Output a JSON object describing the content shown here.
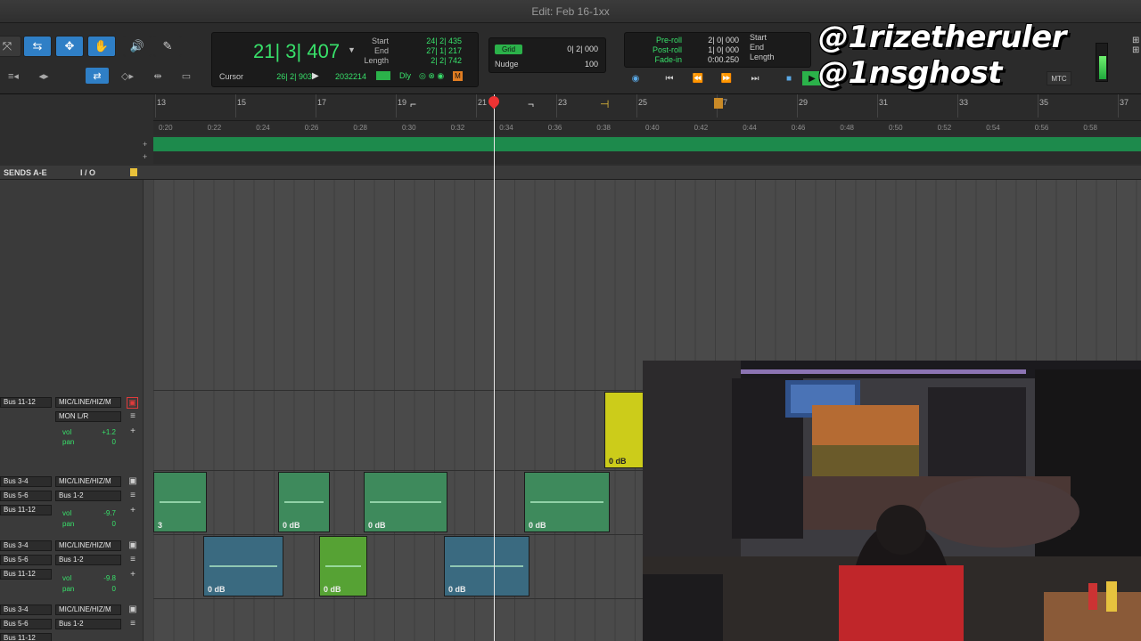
{
  "window": {
    "title": "Edit: Feb 16-1xx"
  },
  "counter": {
    "main": "21| 3| 407",
    "start_label": "Start",
    "start_value": "24| 2| 435",
    "end_label": "End",
    "end_value": "27| 1| 217",
    "length_label": "Length",
    "length_value": "2| 2| 742",
    "cursor_label": "Cursor",
    "cursor_value": "26| 2| 903",
    "samples": "2032214",
    "dly_label": "Dly",
    "m_label": "M"
  },
  "grid": {
    "label": "Grid",
    "value": "0| 2| 000",
    "nudge_label": "Nudge",
    "nudge_value": "100"
  },
  "preroll": {
    "preroll_label": "Pre-roll",
    "preroll_value": "2| 0| 000",
    "postroll_label": "Post-roll",
    "postroll_value": "1| 0| 000",
    "fadein_label": "Fade-in",
    "fadein_value": "0:00.250",
    "start_label": "Start",
    "end_label": "End",
    "length_label": "Length"
  },
  "transport": {
    "mtc": "MTC"
  },
  "overlay": {
    "line1": "@1rizetheruler",
    "line2": "@1nsghost"
  },
  "bar_ruler": [
    "13",
    "15",
    "17",
    "19",
    "21",
    "23",
    "25",
    "27",
    "29",
    "31",
    "33",
    "35",
    "37"
  ],
  "time_ruler": [
    "0:20",
    "0:22",
    "0:24",
    "0:26",
    "0:28",
    "0:30",
    "0:32",
    "0:34",
    "0:36",
    "0:38",
    "0:40",
    "0:42",
    "0:44",
    "0:46",
    "0:48",
    "0:50",
    "0:52",
    "0:54",
    "0:56",
    "0:58"
  ],
  "header": {
    "sends": "SENDS A-E",
    "io": "I / O"
  },
  "tracks": [
    {
      "in": "Bus 11-12",
      "out": "MIC/LINE/HIZ/M",
      "out2": "MON L/R",
      "vol_label": "vol",
      "vol": "+1.2",
      "pan_label": "pan",
      "pan": "0"
    },
    {
      "in": "Bus 3-4",
      "in2": "Bus 5-6",
      "in3": "Bus 11-12",
      "out": "MIC/LINE/HIZ/M",
      "out2": "Bus 1-2",
      "vol_label": "vol",
      "vol": "-9.7",
      "pan_label": "pan",
      "pan": "0"
    },
    {
      "in": "Bus 3-4",
      "in2": "Bus 5-6",
      "in3": "Bus 11-12",
      "out": "MIC/LINE/HIZ/M",
      "out2": "Bus 1-2",
      "vol_label": "vol",
      "vol": "-9.8",
      "pan_label": "pan",
      "pan": "0"
    },
    {
      "in": "Bus 3-4",
      "in2": "Bus 5-6",
      "in3": "Bus 11-12",
      "out": "MIC/LINE/HIZ/M",
      "out2": "Bus 1-2"
    }
  ],
  "clips": {
    "db": "0 dB",
    "first_clip_number": "3"
  }
}
